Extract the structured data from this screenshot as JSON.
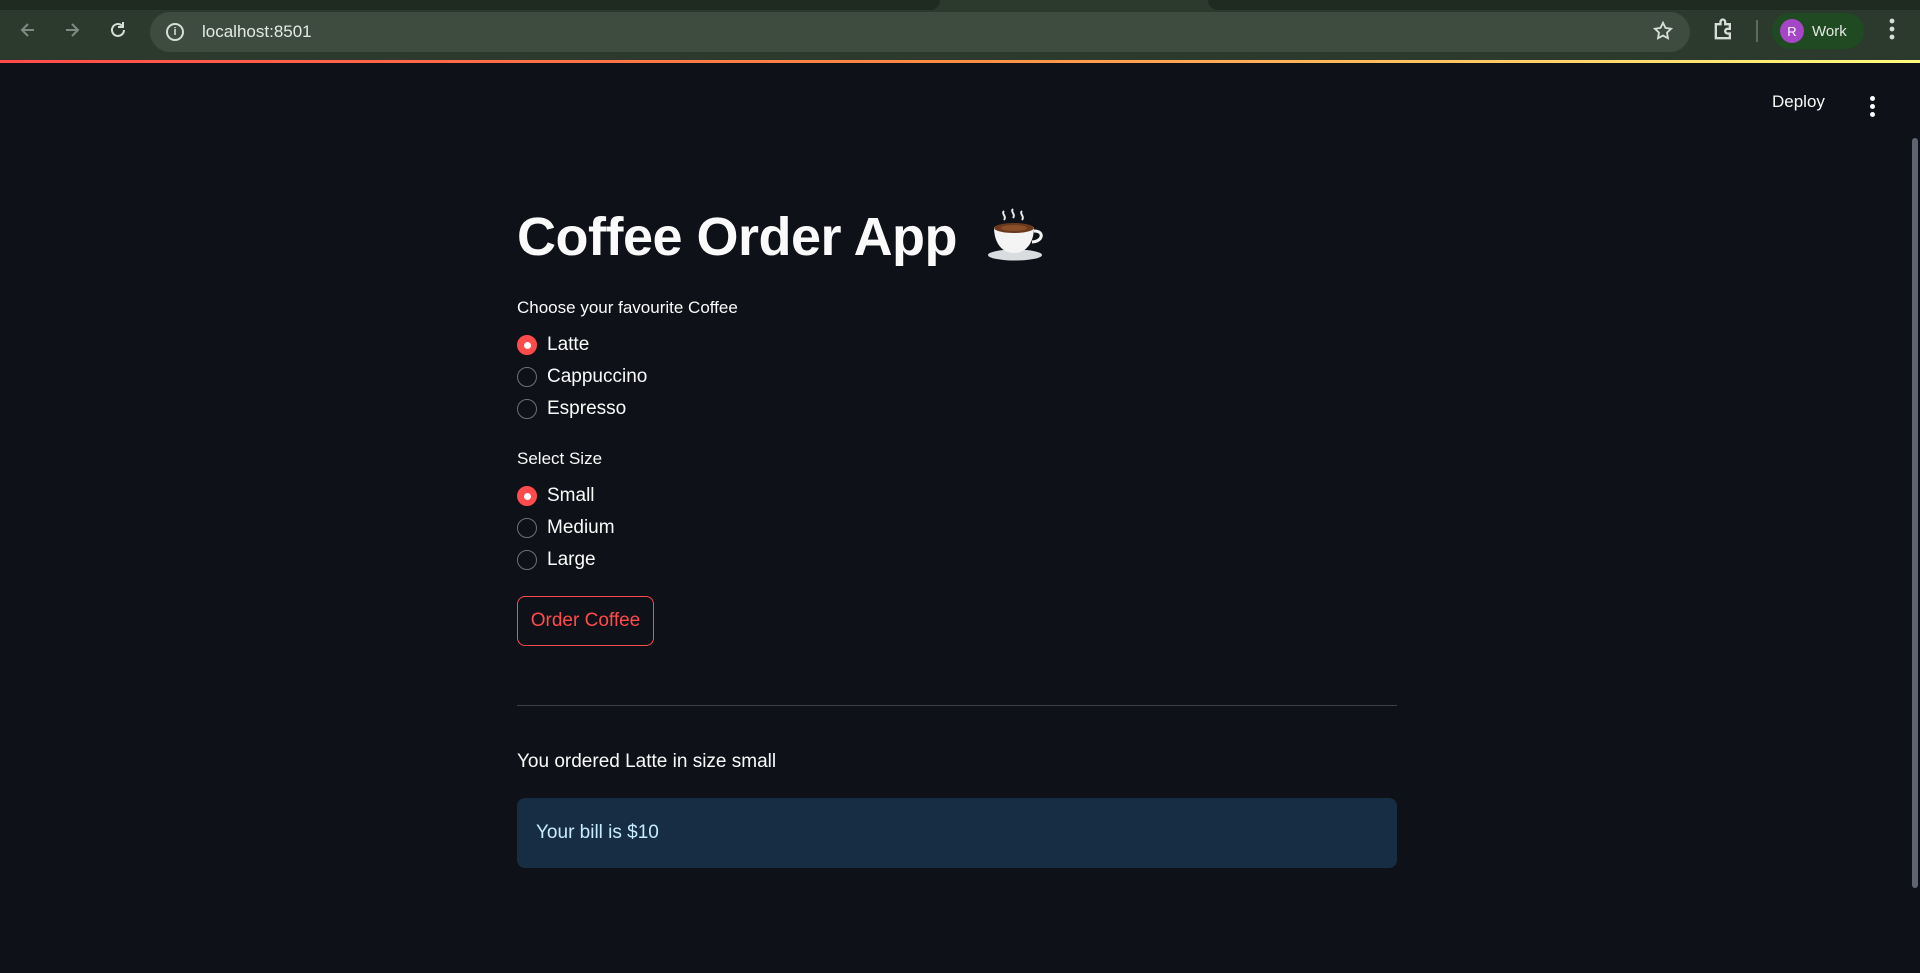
{
  "browser": {
    "url": "localhost:8501",
    "profile_initial": "R",
    "profile_name": "Work",
    "icons": [
      "back-arrow-icon",
      "forward-arrow-icon",
      "reload-icon",
      "site-info-icon",
      "bookmark-star-icon",
      "extensions-puzzle-icon",
      "chrome-menu-icon"
    ]
  },
  "app_header": {
    "deploy_label": "Deploy",
    "menu_icon": "vertical-dots-icon"
  },
  "main": {
    "title": "Coffee Order App",
    "title_icon": "hot-coffee-cup-icon",
    "coffee_question": "Choose your favourite Coffee",
    "coffee_options": [
      "Latte",
      "Cappuccino",
      "Espresso"
    ],
    "coffee_selected": "Latte",
    "size_question": "Select Size",
    "size_options": [
      "Small",
      "Medium",
      "Large"
    ],
    "size_selected": "Small",
    "order_button": "Order Coffee",
    "order_summary": "You ordered Latte in size small",
    "bill_text": "Your bill is $10"
  },
  "colors": {
    "background": "#0e1117",
    "accent": "#ff4b4b",
    "info_bg": "#172d43",
    "info_text": "#c7ebff"
  }
}
